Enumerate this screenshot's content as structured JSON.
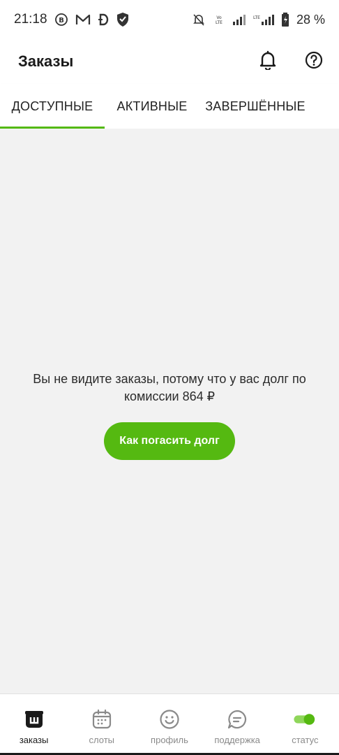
{
  "status_bar": {
    "time": "21:18",
    "battery": "28 %",
    "icons": [
      "b-circle-icon",
      "m-app-icon",
      "d-app-icon",
      "shield-icon",
      "bell-off-icon",
      "volte-icon",
      "signal-icon",
      "lte-signal-icon",
      "battery-icon"
    ]
  },
  "header": {
    "title": "Заказы",
    "icons": [
      "bell-icon",
      "help-icon"
    ]
  },
  "tabs": [
    {
      "label": "ДОСТУПНЫЕ",
      "active": true
    },
    {
      "label": "АКТИВНЫЕ",
      "active": false
    },
    {
      "label": "ЗАВЕРШЁННЫЕ",
      "active": false
    }
  ],
  "main": {
    "message": "Вы не видите заказы, потому что у вас долг по комиссии 864 ₽",
    "button_label": "Как погасить долг"
  },
  "bottom_nav": [
    {
      "label": "заказы",
      "icon": "orders-icon",
      "active": true
    },
    {
      "label": "слоты",
      "icon": "calendar-icon",
      "active": false
    },
    {
      "label": "профиль",
      "icon": "smiley-icon",
      "active": false
    },
    {
      "label": "поддержка",
      "icon": "chat-icon",
      "active": false
    },
    {
      "label": "статус",
      "icon": "status-toggle",
      "active": false
    }
  ],
  "colors": {
    "accent": "#55b911",
    "background": "#f2f2f2",
    "surface": "#ffffff"
  }
}
